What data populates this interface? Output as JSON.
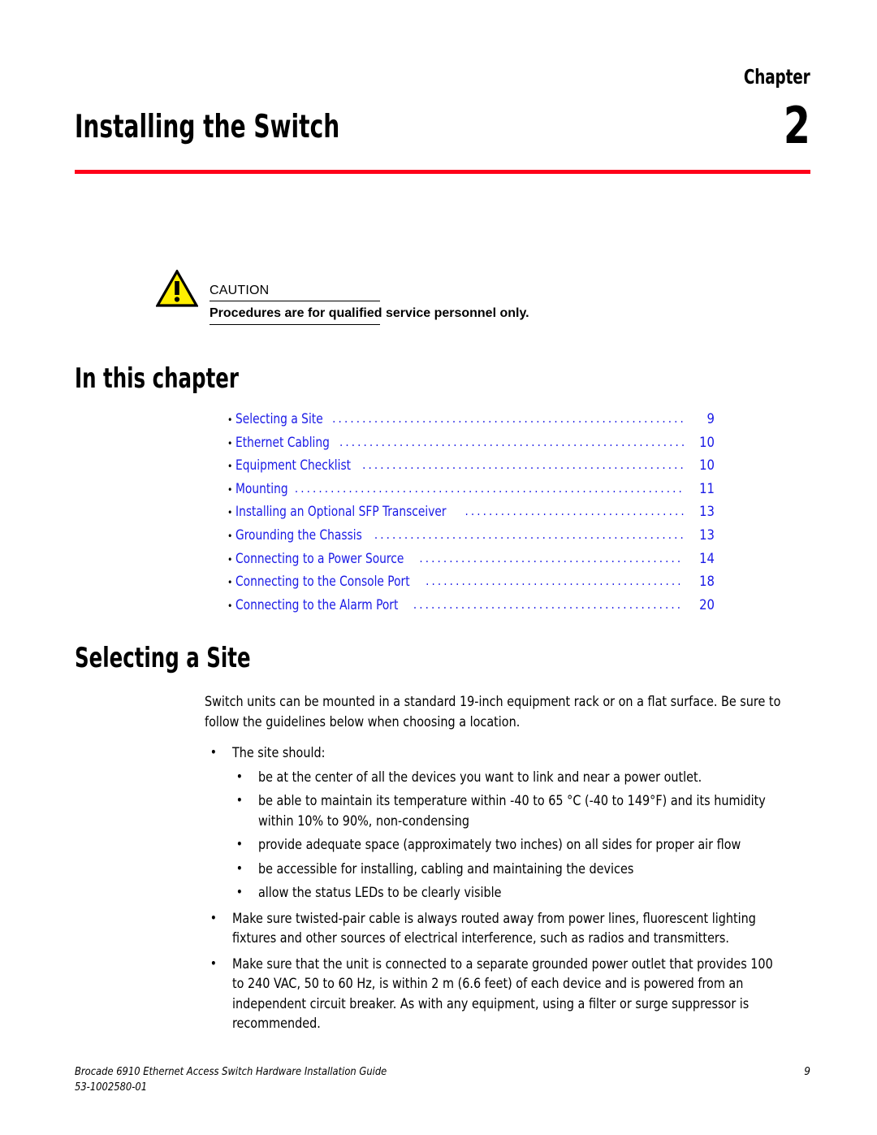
{
  "header": {
    "chapter_label": "Chapter",
    "chapter_number": "2",
    "chapter_title": "Installing the Switch",
    "rule_color": "#ff0019"
  },
  "caution": {
    "icon": "warning-triangle-icon",
    "label": "CAUTION",
    "text": "Procedures are for qualified service personnel only.",
    "icon_fill": "#ffee00",
    "icon_stroke": "#000000"
  },
  "sections": {
    "in_this_chapter_heading": "In this chapter",
    "selecting_a_site_heading": "Selecting a Site"
  },
  "toc": {
    "link_color": "#1a1ae6",
    "leader": "...............................................................................",
    "items": [
      {
        "label": "Selecting a Site",
        "page": "9"
      },
      {
        "label": "Ethernet Cabling",
        "page": "10"
      },
      {
        "label": "Equipment Checklist",
        "page": "10"
      },
      {
        "label": "Mounting",
        "page": "11"
      },
      {
        "label": "Installing an Optional SFP Transceiver",
        "page": "13"
      },
      {
        "label": "Grounding the Chassis",
        "page": "13"
      },
      {
        "label": "Connecting to a Power Source",
        "page": "14"
      },
      {
        "label": "Connecting to the Console Port",
        "page": "18"
      },
      {
        "label": "Connecting to the Alarm Port",
        "page": "20"
      }
    ]
  },
  "content": {
    "intro_paragraph": "Switch units can be mounted in a standard 19-inch equipment rack or on a flat surface. Be sure to follow the guidelines below when choosing a location.",
    "bullet_site_should": "The site should:",
    "site_sub_bullets": [
      "be at the center of all the devices you want to link and near a power outlet.",
      "be able to maintain its temperature within -40 to 65 °C (-40 to 149°F) and its humidity within 10% to 90%, non-condensing",
      "provide adequate space (approximately two inches) on all sides for proper air flow",
      "be accessible for installing, cabling and maintaining the devices",
      "allow the status LEDs to be clearly visible"
    ],
    "bullet_twisted_pair": "Make sure twisted-pair cable is always routed away from power lines, fluorescent lighting fixtures and other sources of electrical interference, such as radios and transmitters.",
    "bullet_power_outlet": "Make sure that the unit is connected to a separate grounded power outlet that provides 100 to 240 VAC, 50 to 60 Hz, is within 2 m (6.6 feet) of each device and is powered from an independent circuit breaker. As with any equipment, using a filter or surge suppressor is recommended.",
    "bullet_glyph": "•"
  },
  "footer": {
    "document_title": "Brocade 6910 Ethernet Access Switch Hardware Installation Guide",
    "document_number": "53-1002580-01",
    "page_number": "9"
  }
}
